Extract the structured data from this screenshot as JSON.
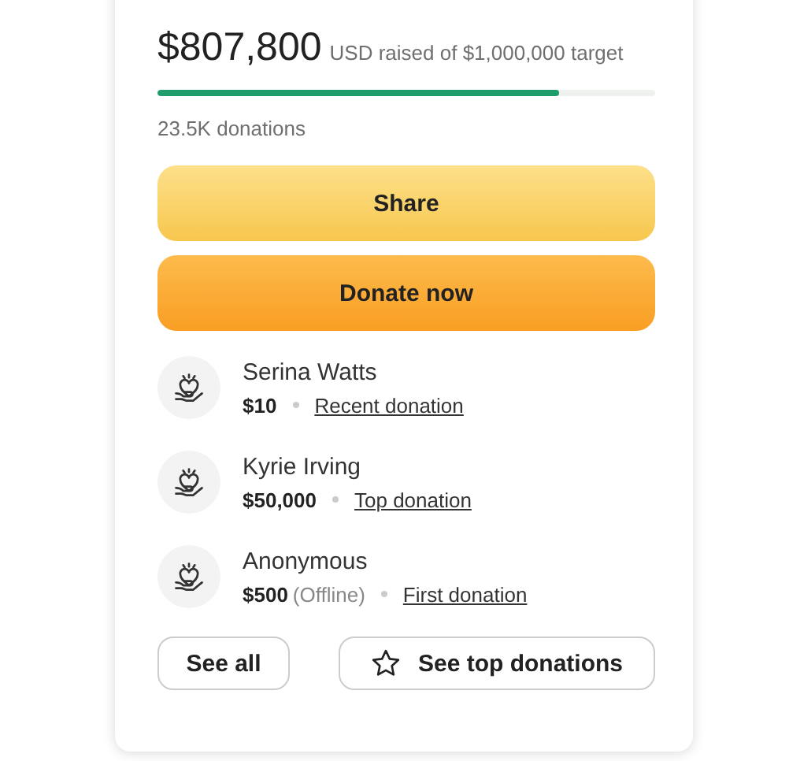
{
  "amount": "$807,800",
  "goal_text": "USD raised of $1,000,000 target",
  "progress": {
    "level": 0.807
  },
  "count": "23.5K donations",
  "buttons": [
    {
      "label": "Share",
      "kind": "share"
    },
    {
      "label": "Donate now",
      "kind": "donate"
    }
  ],
  "donors": [
    {
      "name": "Serina Watts",
      "amount": "$10",
      "link": "Recent donation"
    },
    {
      "name": "Kyrie Irving",
      "amount": "$50,000",
      "link": "Top donation"
    },
    {
      "name": "Anonymous",
      "amount": "$500",
      "note": "(Offline)",
      "link": "First donation"
    }
  ],
  "footer_buttons": [
    {
      "label": "See all",
      "kind": "plain"
    },
    {
      "label": "See top donations",
      "kind": "starred"
    }
  ]
}
